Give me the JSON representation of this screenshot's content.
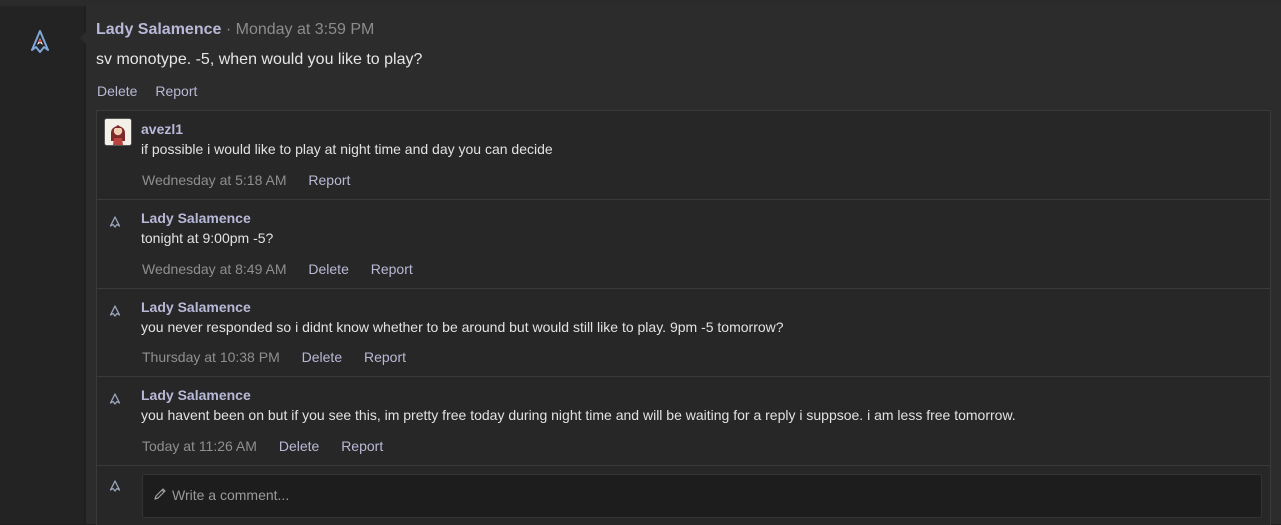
{
  "post": {
    "author": "Lady Salamence",
    "separator": " · ",
    "timestamp": "Monday at 3:59 PM",
    "body": "sv monotype. -5, when would you like to play?",
    "actions": {
      "delete": "Delete",
      "report": "Report"
    }
  },
  "comments": [
    {
      "author": "avezl1",
      "text": "if possible i would like to play at night time and day you can decide",
      "time": "Wednesday at 5:18 AM",
      "report": "Report"
    },
    {
      "author": "Lady Salamence",
      "text": "tonight at 9:00pm -5?",
      "time": "Wednesday at 8:49 AM",
      "delete": "Delete",
      "report": "Report"
    },
    {
      "author": "Lady Salamence",
      "text": "you never responded so i didnt know whether to be around but would still like to play. 9pm -5 tomorrow?",
      "time": "Thursday at 10:38 PM",
      "delete": "Delete",
      "report": "Report"
    },
    {
      "author": "Lady Salamence",
      "text": "you havent been on but if you see this, im pretty free today during night time and will be waiting for a reply i suppsoe. i am less free tomorrow.",
      "time": "Today at 11:26 AM",
      "delete": "Delete",
      "report": "Report"
    }
  ],
  "compose": {
    "placeholder": "Write a comment..."
  },
  "icons": {
    "user_avatar": "salamence-avatar-icon",
    "comment_avatar": "flame-avatar-icon",
    "compose_icon": "pencil-icon"
  },
  "colors": {
    "accent_link": "#b9b9d6",
    "author_name": "#b8b8d8",
    "background": "#2c2c2c"
  }
}
